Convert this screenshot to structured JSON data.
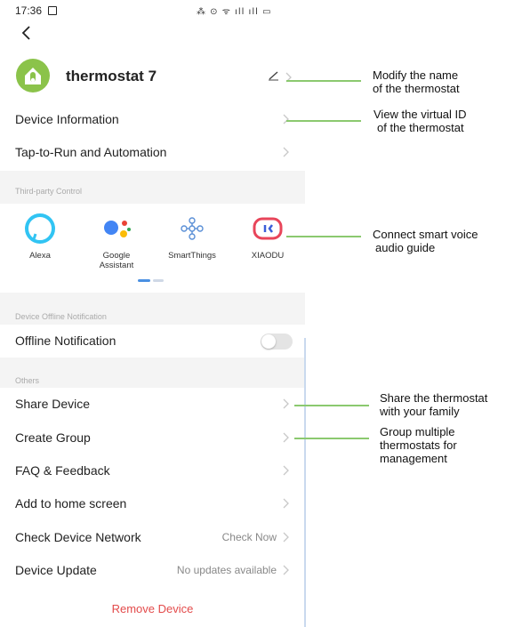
{
  "status": {
    "time": "17:36",
    "icons_text": "⁂ ⊙ ᯤ ıll ıll ▭"
  },
  "device": {
    "name": "thermostat 7"
  },
  "rows_top": [
    {
      "label": "Device Information"
    },
    {
      "label": "Tap-to-Run and Automation"
    }
  ],
  "third_party": {
    "section_label": "Third-party Control",
    "items": [
      {
        "label": "Alexa",
        "icon": "alexa-icon"
      },
      {
        "label": "Google Assistant",
        "icon": "google-assistant-icon"
      },
      {
        "label": "SmartThings",
        "icon": "smartthings-icon"
      },
      {
        "label": "XIAODU",
        "icon": "xiaodu-icon"
      }
    ]
  },
  "offline": {
    "section_label": "Device Offline Notification",
    "label": "Offline Notification",
    "enabled": false
  },
  "others": {
    "section_label": "Others",
    "rows": [
      {
        "label": "Share Device",
        "value": ""
      },
      {
        "label": "Create Group",
        "value": ""
      },
      {
        "label": "FAQ & Feedback",
        "value": ""
      },
      {
        "label": "Add to home screen",
        "value": ""
      },
      {
        "label": "Check Device Network",
        "value": "Check Now"
      },
      {
        "label": "Device Update",
        "value": "No updates available"
      }
    ]
  },
  "remove_label": "Remove Device",
  "annotations": [
    {
      "line1": "Modify the name",
      "line2": "of the thermostat",
      "line3": ""
    },
    {
      "line1": "View the virtual ID",
      "line2": "of the thermostat",
      "line3": ""
    },
    {
      "line1": "Connect smart voice",
      "line2": "audio guide",
      "line3": ""
    },
    {
      "line1": "Share the thermostat",
      "line2": "with your family",
      "line3": ""
    },
    {
      "line1": "Group multiple",
      "line2": "thermostats for",
      "line3": "management"
    }
  ],
  "colors": {
    "accent_green": "#8bc34a",
    "annotation_line": "#8bc96f",
    "danger": "#e34b4b"
  }
}
